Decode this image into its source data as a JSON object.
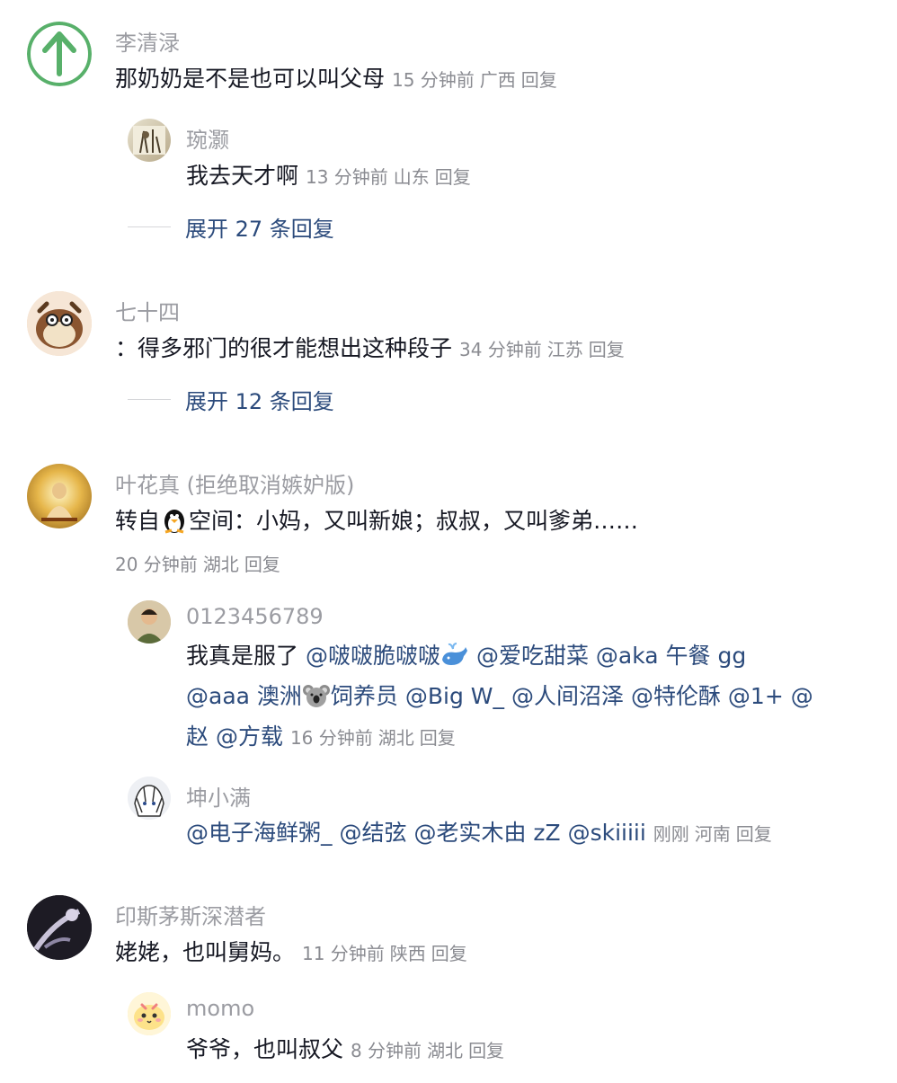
{
  "comments": [
    {
      "user": "李清渌",
      "text": "那奶奶是不是也可以叫父母",
      "time": "15 分钟前",
      "region": "广西",
      "reply": "回复",
      "replies": [
        {
          "user": "琬灏",
          "text": "我去天才啊",
          "time": "13 分钟前",
          "region": "山东",
          "reply": "回复"
        }
      ],
      "expand": "展开 27 条回复"
    },
    {
      "user": "七十四",
      "text": "：得多邪门的很才能想出这种段子",
      "time": "34 分钟前",
      "region": "江苏",
      "reply": "回复",
      "expand": "展开 12 条回复"
    },
    {
      "user": "叶花真 (拒绝取消嫉妒版)",
      "text_before": "转自",
      "text_after": "空间：小妈，又叫新娘；叔叔，又叫爹弟……",
      "time": "20 分钟前",
      "region": "湖北",
      "reply": "回复",
      "replies": [
        {
          "user": "0123456789",
          "line1_a": "我真是服了",
          "m1": "@啵啵脆啵啵",
          "m2": "@爱吃甜菜",
          "m3": "@aka 午餐 gg",
          "m4a": "@aaa 澳洲",
          "m4b": "饲养员",
          "m5": "@Big W_",
          "m6": "@人间沼泽",
          "m7": "@特伦酥",
          "m8": "@1+",
          "m9": "@",
          "m9b": "赵",
          "m10": "@方载",
          "time": "16 分钟前",
          "region": "湖北",
          "reply": "回复"
        },
        {
          "user": "坤小满",
          "m1": "@电子海鲜粥_",
          "m2": "@结弦",
          "m3": "@老实木由 zZ",
          "m4": "@skiiiii",
          "time": "刚刚",
          "region": "河南",
          "reply": "回复"
        }
      ]
    },
    {
      "user": "印斯茅斯深潜者",
      "text": "姥姥，也叫舅妈。",
      "time": "11 分钟前",
      "region": "陕西",
      "reply": "回复",
      "replies": [
        {
          "user": "momo",
          "text": "爷爷，也叫叔父",
          "time": "8 分钟前",
          "region": "湖北",
          "reply": "回复"
        }
      ]
    }
  ],
  "icons": [
    "arrow-up-icon",
    "penguin-icon",
    "whale-icon",
    "koala-icon"
  ],
  "colors": {
    "accent_green": "#58b06a",
    "link_blue": "#2c4b7c",
    "meta_gray": "#8a8b91"
  }
}
